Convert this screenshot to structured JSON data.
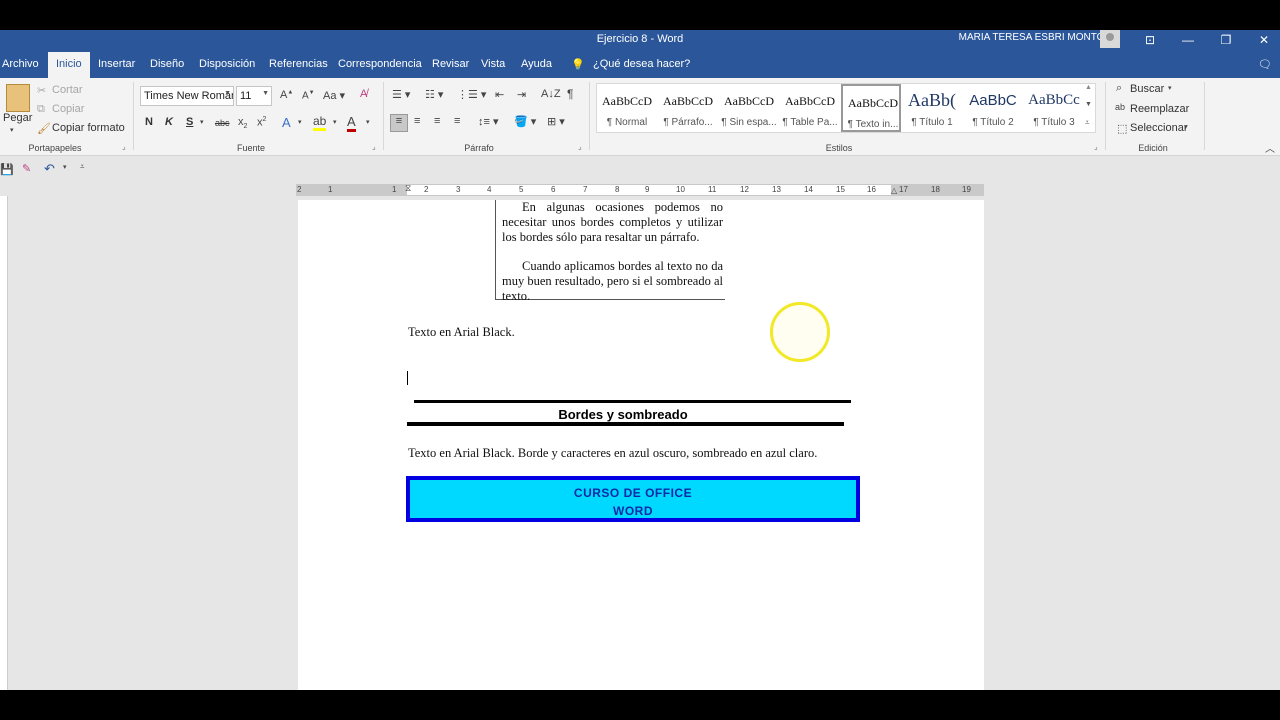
{
  "window": {
    "title": "Ejercicio 8  -  Word",
    "user": "MARIA TERESA ESBRI MONTOLIU"
  },
  "menu": {
    "items": [
      "Archivo",
      "Inicio",
      "Insertar",
      "Diseño",
      "Disposición",
      "Referencias",
      "Correspondencia",
      "Revisar",
      "Vista",
      "Ayuda"
    ],
    "tell_me": "¿Qué desea hacer?"
  },
  "ribbon": {
    "clipboard": {
      "paste": "Pegar",
      "cut": "Cortar",
      "copy": "Copiar",
      "format_painter": "Copiar formato",
      "label": "Portapapeles"
    },
    "font": {
      "name": "Times New Roman",
      "size": "11",
      "bold": "N",
      "italic": "K",
      "underline": "S",
      "strike": "abc",
      "label": "Fuente"
    },
    "paragraph": {
      "label": "Párrafo"
    },
    "styles": {
      "label": "Estilos",
      "items": [
        {
          "preview": "AaBbCcD",
          "name": "¶ Normal"
        },
        {
          "preview": "AaBbCcD",
          "name": "¶ Párrafo..."
        },
        {
          "preview": "AaBbCcD",
          "name": "¶ Sin espa..."
        },
        {
          "preview": "AaBbCcD",
          "name": "¶ Table Pa..."
        },
        {
          "preview": "AaBbCcD",
          "name": "¶ Texto in..."
        },
        {
          "preview": "AaBb(",
          "name": "¶ Título 1"
        },
        {
          "preview": "AaBbC",
          "name": "¶ Título 2"
        },
        {
          "preview": "AaBbCc",
          "name": "¶ Título 3"
        }
      ],
      "selected_index": 4
    },
    "editing": {
      "find": "Buscar",
      "replace": "Reemplazar",
      "select": "Seleccionar",
      "label": "Edición"
    }
  },
  "ruler": {
    "ticks": [
      "2",
      "1",
      "1",
      "2",
      "3",
      "4",
      "5",
      "6",
      "7",
      "8",
      "9",
      "10",
      "11",
      "12",
      "13",
      "14",
      "15",
      "16",
      "17",
      "18",
      "19"
    ]
  },
  "document": {
    "boxed_paragraphs": [
      "En algunas ocasiones podemos no necesitar unos bordes completos y utilizar los bordes sólo para resaltar un párrafo.",
      "Cuando aplicamos bordes al texto no da muy buen resultado, pero si el sombreado al texto."
    ],
    "line1": "Texto en Arial Black.",
    "banner": "Bordes y sombreado",
    "line2": "Texto en Arial Black. Borde y caracteres en azul oscuro, sombreado en azul claro.",
    "course_line1": "CURSO DE OFFICE",
    "course_line2": "WORD"
  },
  "colors": {
    "title_bar": "#2b579a",
    "shading": "#00d9ff",
    "border": "#0000e0",
    "highlight": "#f2e826"
  }
}
